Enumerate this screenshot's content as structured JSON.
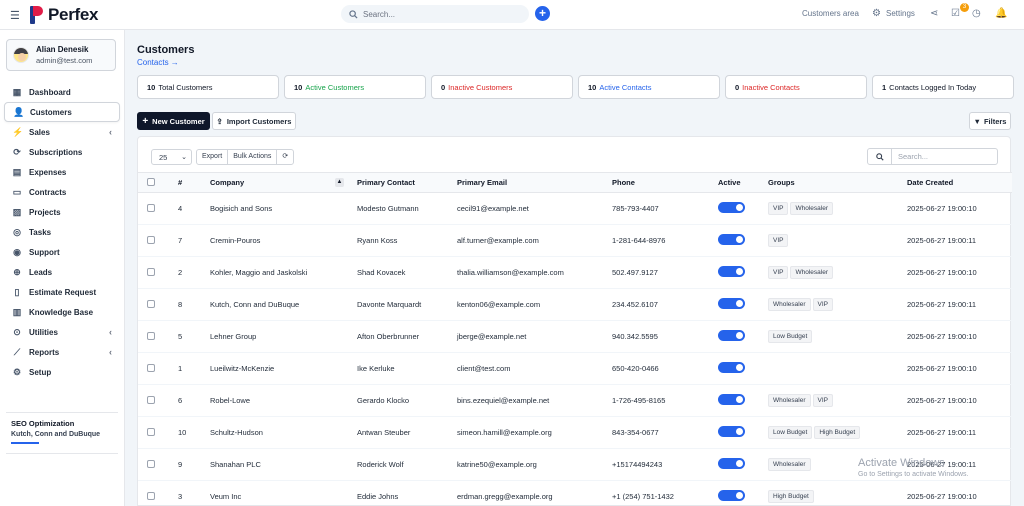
{
  "app": {
    "name": "Perfex",
    "search_placeholder": "Search..."
  },
  "topbar": {
    "customers_area": "Customers area",
    "settings": "Settings",
    "notification_badge": "3"
  },
  "user": {
    "name": "Alian Denesik",
    "email": "admin@test.com"
  },
  "nav": [
    {
      "label": "Dashboard",
      "icon": "dashboard-icon",
      "glyph": "▦",
      "has_chevron": false
    },
    {
      "label": "Customers",
      "icon": "user-icon",
      "glyph": "👤",
      "has_chevron": false,
      "active": true
    },
    {
      "label": "Sales",
      "icon": "bolt-icon",
      "glyph": "⚡",
      "has_chevron": true
    },
    {
      "label": "Subscriptions",
      "icon": "refresh-icon",
      "glyph": "⟳",
      "has_chevron": false
    },
    {
      "label": "Expenses",
      "icon": "receipt-icon",
      "glyph": "▤",
      "has_chevron": false
    },
    {
      "label": "Contracts",
      "icon": "document-icon",
      "glyph": "▭",
      "has_chevron": false
    },
    {
      "label": "Projects",
      "icon": "chart-icon",
      "glyph": "▨",
      "has_chevron": false
    },
    {
      "label": "Tasks",
      "icon": "check-circle-icon",
      "glyph": "◎",
      "has_chevron": false
    },
    {
      "label": "Support",
      "icon": "support-icon",
      "glyph": "◉",
      "has_chevron": false
    },
    {
      "label": "Leads",
      "icon": "target-icon",
      "glyph": "⊕",
      "has_chevron": false
    },
    {
      "label": "Estimate Request",
      "icon": "file-icon",
      "glyph": "▯",
      "has_chevron": false
    },
    {
      "label": "Knowledge Base",
      "icon": "book-icon",
      "glyph": "▥",
      "has_chevron": false
    },
    {
      "label": "Utilities",
      "icon": "cog-circle-icon",
      "glyph": "⊙",
      "has_chevron": true
    },
    {
      "label": "Reports",
      "icon": "line-chart-icon",
      "glyph": "⟋",
      "has_chevron": true
    },
    {
      "label": "Setup",
      "icon": "gear-icon",
      "glyph": "⚙",
      "has_chevron": false
    }
  ],
  "seo": {
    "title": "SEO Optimization",
    "subtitle": "Kutch, Conn and DuBuque"
  },
  "page": {
    "title": "Customers",
    "contacts_link": "Contacts →"
  },
  "stats": [
    {
      "count": "10",
      "label": "Total Customers",
      "color": "#111827"
    },
    {
      "count": "10",
      "label": "Active Customers",
      "color": "#16a34a"
    },
    {
      "count": "0",
      "label": "Inactive Customers",
      "color": "#dc2626"
    },
    {
      "count": "10",
      "label": "Active Contacts",
      "color": "#2563eb"
    },
    {
      "count": "0",
      "label": "Inactive Contacts",
      "color": "#dc2626"
    },
    {
      "count": "1",
      "label": "Contacts Logged In Today",
      "color": "#111827"
    }
  ],
  "actions": {
    "new_customer": "New Customer",
    "import_customers": "Import Customers",
    "filters": "Filters"
  },
  "table_tools": {
    "page_size": "25",
    "export": "Export",
    "bulk_actions": "Bulk Actions",
    "search_placeholder": "Search..."
  },
  "table": {
    "headers": [
      "#",
      "Company",
      "Primary Contact",
      "Primary Email",
      "Phone",
      "Active",
      "Groups",
      "Date Created"
    ],
    "rows": [
      {
        "id": "4",
        "company": "Bogisich and Sons",
        "contact": "Modesto Gutmann",
        "email": "cecil91@example.net",
        "phone": "785-793-4407",
        "active": true,
        "groups": [
          "VIP",
          "Wholesaler"
        ],
        "date": "2025-06-27 19:00:10"
      },
      {
        "id": "7",
        "company": "Cremin-Pouros",
        "contact": "Ryann Koss",
        "email": "alf.turner@example.com",
        "phone": "1-281-644-8976",
        "active": true,
        "groups": [
          "VIP"
        ],
        "date": "2025-06-27 19:00:11"
      },
      {
        "id": "2",
        "company": "Kohler, Maggio and Jaskolski",
        "contact": "Shad Kovacek",
        "email": "thalia.williamson@example.com",
        "phone": "502.497.9127",
        "active": true,
        "groups": [
          "VIP",
          "Wholesaler"
        ],
        "date": "2025-06-27 19:00:10"
      },
      {
        "id": "8",
        "company": "Kutch, Conn and DuBuque",
        "contact": "Davonte Marquardt",
        "email": "kenton06@example.com",
        "phone": "234.452.6107",
        "active": true,
        "groups": [
          "Wholesaler",
          "VIP"
        ],
        "date": "2025-06-27 19:00:11"
      },
      {
        "id": "5",
        "company": "Lehner Group",
        "contact": "Afton Oberbrunner",
        "email": "jberge@example.net",
        "phone": "940.342.5595",
        "active": true,
        "groups": [
          "Low Budget"
        ],
        "date": "2025-06-27 19:00:10"
      },
      {
        "id": "1",
        "company": "Lueilwitz-McKenzie",
        "contact": "Ike Kerluke",
        "email": "client@test.com",
        "phone": "650-420-0466",
        "active": true,
        "groups": [],
        "date": "2025-06-27 19:00:10"
      },
      {
        "id": "6",
        "company": "Robel-Lowe",
        "contact": "Gerardo Klocko",
        "email": "bins.ezequiel@example.net",
        "phone": "1-726-495-8165",
        "active": true,
        "groups": [
          "Wholesaler",
          "VIP"
        ],
        "date": "2025-06-27 19:00:10"
      },
      {
        "id": "10",
        "company": "Schultz-Hudson",
        "contact": "Antwan Steuber",
        "email": "simeon.hamill@example.org",
        "phone": "843-354-0677",
        "active": true,
        "groups": [
          "Low Budget",
          "High Budget"
        ],
        "date": "2025-06-27 19:00:11"
      },
      {
        "id": "9",
        "company": "Shanahan PLC",
        "contact": "Roderick Wolf",
        "email": "katrine50@example.org",
        "phone": "+15174494243",
        "active": true,
        "groups": [
          "Wholesaler"
        ],
        "date": "2025-06-27 19:00:11"
      },
      {
        "id": "3",
        "company": "Veum Inc",
        "contact": "Eddie Johns",
        "email": "erdman.gregg@example.org",
        "phone": "+1 (254) 751-1432",
        "active": true,
        "groups": [
          "High Budget"
        ],
        "date": "2025-06-27 19:00:10"
      }
    ]
  },
  "watermark": {
    "line1": "Activate Windows",
    "line2": "Go to Settings to activate Windows."
  }
}
